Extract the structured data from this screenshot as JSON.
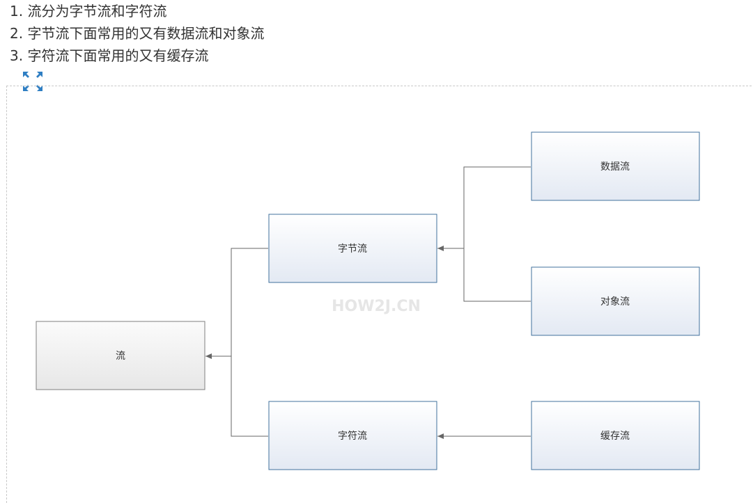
{
  "intro_list": [
    "1. 流分为字节流和字符流",
    "2. 字节流下面常用的又有数据流和对象流",
    "3. 字符流下面常用的又有缓存流"
  ],
  "expand_icon": "fullscreen-expand-icon",
  "colors": {
    "accent": "#2e7ec3",
    "node_border_blue": "#41719c",
    "node_fill_blue": "#e9eef7",
    "node_border_gray": "#7f7f7f",
    "node_fill_gray": "#efefef",
    "connector": "#666666"
  },
  "diagram": {
    "nodes": {
      "stream": "流",
      "byte_stream": "字节流",
      "char_stream": "字符流",
      "data_stream": "数据流",
      "object_stream": "对象流",
      "buffered_stream": "缓存流"
    },
    "edges": [
      [
        "byte_stream",
        "stream"
      ],
      [
        "char_stream",
        "stream"
      ],
      [
        "data_stream",
        "byte_stream"
      ],
      [
        "object_stream",
        "byte_stream"
      ],
      [
        "buffered_stream",
        "char_stream"
      ]
    ],
    "watermark": "HOW2J.CN"
  }
}
